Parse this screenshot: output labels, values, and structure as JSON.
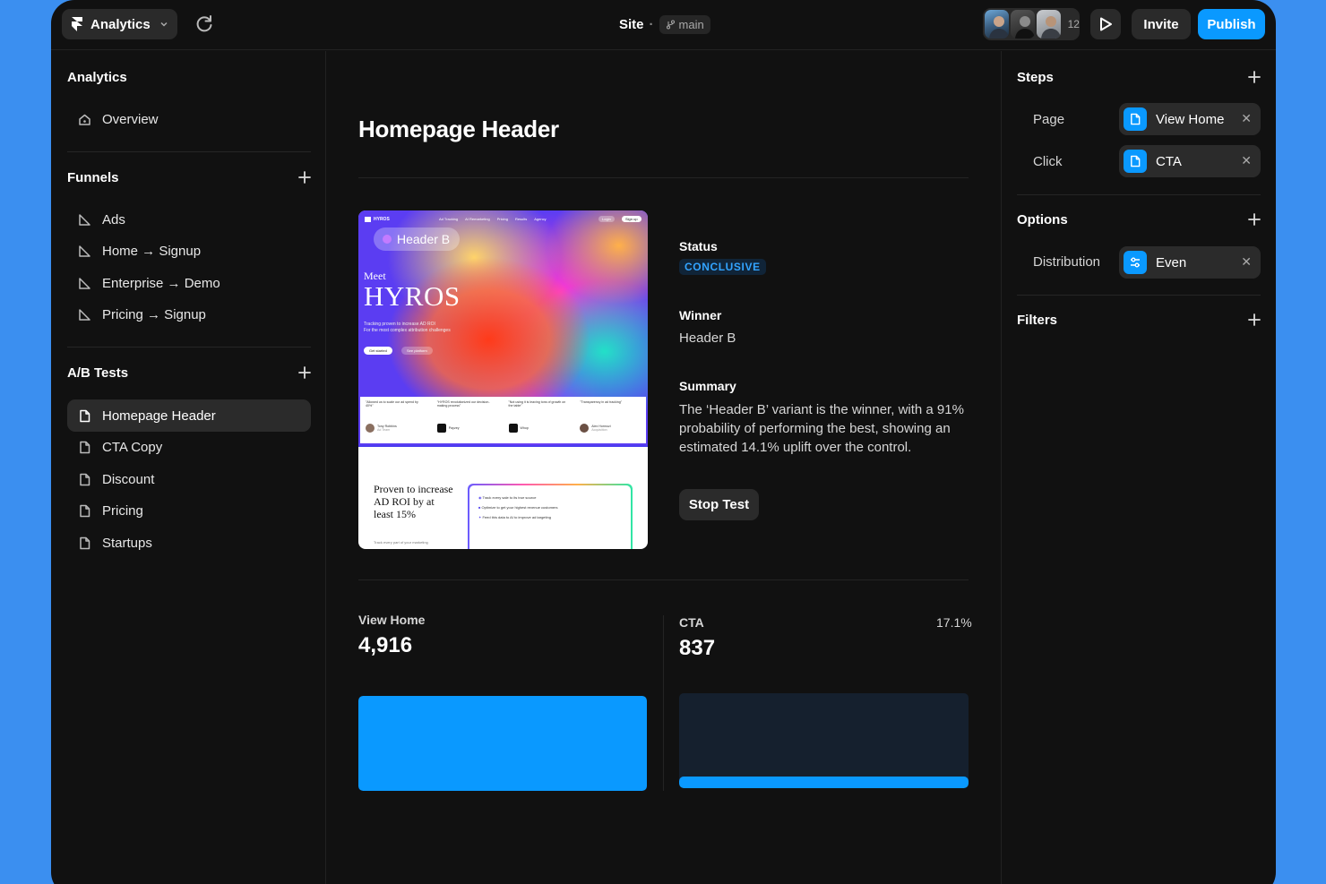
{
  "topbar": {
    "app_menu_label": "Analytics",
    "project_name": "Site",
    "separator": "·",
    "branch_name": "main",
    "collaborator_count": "12",
    "invite_label": "Invite",
    "publish_label": "Publish"
  },
  "sidebar": {
    "analytics_title": "Analytics",
    "overview_label": "Overview",
    "funnels_title": "Funnels",
    "funnels": [
      "Ads",
      "Home → Signup",
      "Enterprise → Demo",
      "Pricing → Signup"
    ],
    "abtests_title": "A/B Tests",
    "abtests": [
      "Homepage Header",
      "CTA Copy",
      "Discount",
      "Pricing",
      "Startups"
    ],
    "active_abtest": "Homepage Header"
  },
  "main": {
    "title": "Homepage Header",
    "preview": {
      "variant_pill": "Header B",
      "brand": "HYROS",
      "nav_items": [
        "Ad Tracking",
        "AI Remarketing",
        "Pricing",
        "Results",
        "Agency"
      ],
      "login": "Login",
      "signup": "Sign up",
      "meet": "Meet",
      "headline": "HYROS",
      "tagline": "Tracking proven to increase AD ROI\nFor the most complex attribution challenges",
      "cta_primary": "Get started",
      "cta_secondary": "See platform",
      "testimonials": [
        {
          "quote": "\"Allowed us to scale our ad spend by 40%\"",
          "name": "Tony Robbins",
          "role": "Ad Team"
        },
        {
          "quote": "\"HYROS revolutionized our decision-making process\"",
          "name": "Payzey",
          "role": ""
        },
        {
          "quote": "\"Not using it is leaving tons of growth on the table\"",
          "name": "Whop",
          "role": ""
        },
        {
          "quote": "\"Transparency in ad tracking\"",
          "name": "Alex Hormozi",
          "role": "Acquisition"
        }
      ],
      "proof_text": "Proven to increase AD ROI by at least 15%",
      "proof_sub": "Track every part of your marketing",
      "checklist": [
        "Track every sale to its true source",
        "Optimize to get your highest revenue customers",
        "Feed this data to AI to improve ad targeting"
      ]
    },
    "status_label": "Status",
    "status_value": "CONCLUSIVE",
    "winner_label": "Winner",
    "winner_value": "Header B",
    "summary_label": "Summary",
    "summary_text": "The ‘Header B’ variant is the winner, with a 91% probability of performing the best, showing an estimated 14.1% uplift over the control.",
    "stop_label": "Stop Test",
    "stats": [
      {
        "label": "View Home",
        "value": "4,916",
        "percent": "",
        "fill": 1.0
      },
      {
        "label": "CTA",
        "value": "837",
        "percent": "17.1%",
        "fill": 0.171
      }
    ]
  },
  "rightpanel": {
    "steps_title": "Steps",
    "steps": [
      {
        "label": "Page",
        "chip": "View Home"
      },
      {
        "label": "Click",
        "chip": "CTA"
      }
    ],
    "options_title": "Options",
    "options": [
      {
        "label": "Distribution",
        "chip": "Even"
      }
    ],
    "filters_title": "Filters"
  },
  "colors": {
    "accent": "#0a99ff",
    "page_bg": "#3b8ff0",
    "app_bg": "#111111",
    "badge_text": "#33a4ff"
  }
}
